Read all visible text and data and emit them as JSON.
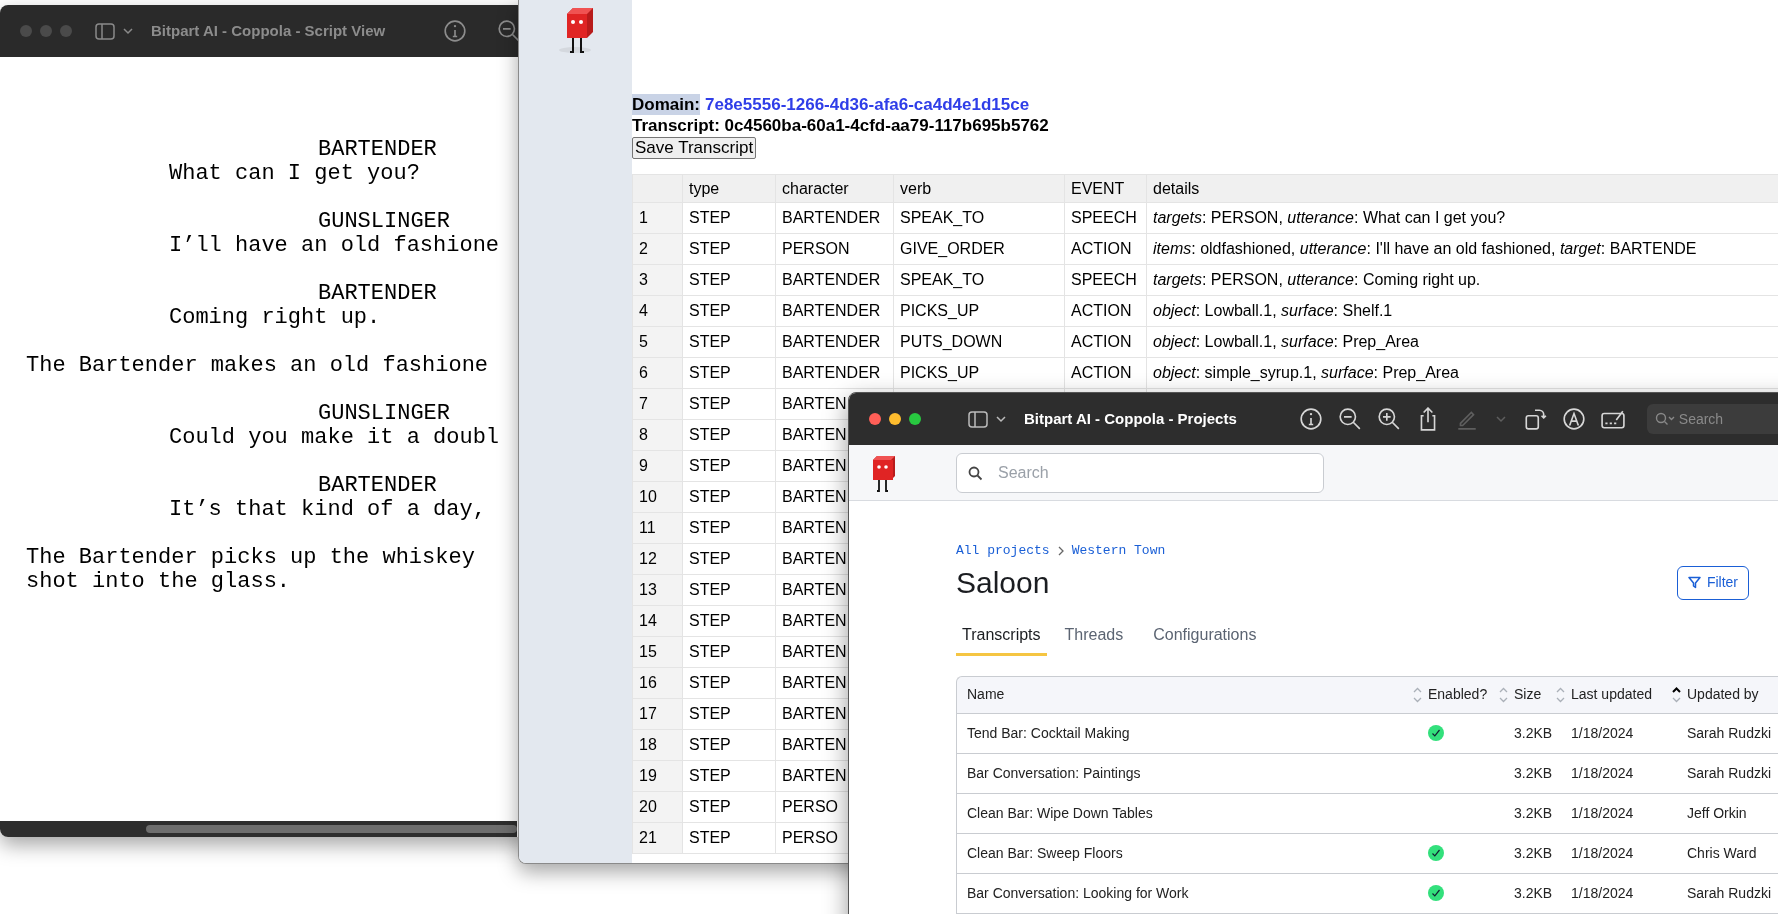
{
  "script_window": {
    "title": "Bitpart AI - Coppola - Script View",
    "active": false,
    "toolbar": [
      {
        "kind": "info",
        "disabled": false
      },
      {
        "kind": "zoom-out",
        "disabled": false
      }
    ],
    "lines": [
      {
        "kind": "character",
        "text": "BARTENDER"
      },
      {
        "kind": "dialogue",
        "text": "What can I get you?"
      },
      {
        "kind": "character",
        "text": "GUNSLINGER"
      },
      {
        "kind": "dialogue",
        "text": "I’ll have an old fashione"
      },
      {
        "kind": "character",
        "text": "BARTENDER"
      },
      {
        "kind": "dialogue",
        "text": "Coming right up."
      },
      {
        "kind": "action",
        "text": "The Bartender makes an old fashione"
      },
      {
        "kind": "character",
        "text": "GUNSLINGER"
      },
      {
        "kind": "dialogue",
        "text": "Could you make it a doubl"
      },
      {
        "kind": "character",
        "text": "BARTENDER"
      },
      {
        "kind": "dialogue",
        "text": "It’s that kind of a day,"
      },
      {
        "kind": "action",
        "text": "The Bartender picks up the whiskey\nshot into the glass."
      }
    ]
  },
  "transcript_window": {
    "domain_label": "Domain:",
    "domain_label_highlighted": true,
    "domain": "7e8e5556-1266-4d36-afa6-ca4d4e1d15ce",
    "transcript": "Transcript: 0c4560ba-60a1-4cfd-aa79-117b695b5762",
    "save_button": "Save Transcript",
    "table": {
      "columns": [
        "type",
        "character",
        "verb",
        "EVENT",
        "details"
      ],
      "rows": [
        {
          "index": "1",
          "type": "STEP",
          "character": "BARTENDER",
          "verb": "SPEAK_TO",
          "event": "SPEECH",
          "details": "*targets*: PERSON, *utterance*: What can I get you?"
        },
        {
          "index": "2",
          "type": "STEP",
          "character": "PERSON",
          "verb": "GIVE_ORDER",
          "event": "ACTION",
          "details": "*items*: oldfashioned, *utterance*: I'll have an old fashioned, *target*: BARTENDE"
        },
        {
          "index": "3",
          "type": "STEP",
          "character": "BARTENDER",
          "verb": "SPEAK_TO",
          "event": "SPEECH",
          "details": "*targets*: PERSON, *utterance*: Coming right up."
        },
        {
          "index": "4",
          "type": "STEP",
          "character": "BARTENDER",
          "verb": "PICKS_UP",
          "event": "ACTION",
          "details": "*object*: Lowball.1, *surface*: Shelf.1"
        },
        {
          "index": "5",
          "type": "STEP",
          "character": "BARTENDER",
          "verb": "PUTS_DOWN",
          "event": "ACTION",
          "details": "*object*: Lowball.1, *surface*: Prep_Area"
        },
        {
          "index": "6",
          "type": "STEP",
          "character": "BARTENDER",
          "verb": "PICKS_UP",
          "event": "ACTION",
          "details": "*object*: simple_syrup.1, *surface*: Prep_Area"
        },
        {
          "index": "7",
          "type": "STEP",
          "character": "BARTEN"
        },
        {
          "index": "8",
          "type": "STEP",
          "character": "BARTEN"
        },
        {
          "index": "9",
          "type": "STEP",
          "character": "BARTEN"
        },
        {
          "index": "10",
          "type": "STEP",
          "character": "BARTEN"
        },
        {
          "index": "11",
          "type": "STEP",
          "character": "BARTEN"
        },
        {
          "index": "12",
          "type": "STEP",
          "character": "BARTEN"
        },
        {
          "index": "13",
          "type": "STEP",
          "character": "BARTEN"
        },
        {
          "index": "14",
          "type": "STEP",
          "character": "BARTEN"
        },
        {
          "index": "15",
          "type": "STEP",
          "character": "BARTEN"
        },
        {
          "index": "16",
          "type": "STEP",
          "character": "BARTEN"
        },
        {
          "index": "17",
          "type": "STEP",
          "character": "BARTEN"
        },
        {
          "index": "18",
          "type": "STEP",
          "character": "BARTEN"
        },
        {
          "index": "19",
          "type": "STEP",
          "character": "BARTEN"
        },
        {
          "index": "20",
          "type": "STEP",
          "character": "PERSO"
        },
        {
          "index": "21",
          "type": "STEP",
          "character": "PERSO"
        }
      ]
    }
  },
  "projects_window": {
    "title": "Bitpart AI - Coppola - Projects",
    "active": true,
    "toolbar": [
      {
        "kind": "info",
        "disabled": false
      },
      {
        "kind": "zoom-out",
        "disabled": false
      },
      {
        "kind": "zoom-in",
        "disabled": false
      },
      {
        "kind": "share",
        "disabled": false
      },
      {
        "kind": "pen",
        "disabled": true
      },
      {
        "kind": "chevron",
        "disabled": true
      },
      {
        "kind": "rotate",
        "disabled": false
      },
      {
        "kind": "markup",
        "disabled": false
      },
      {
        "kind": "signature",
        "disabled": false
      }
    ],
    "toolbar_search": {
      "placeholder": "Search"
    },
    "search": {
      "placeholder": "Search"
    },
    "breadcrumb": [
      "All projects",
      "Western Town"
    ],
    "heading": "Saloon",
    "filter_button": "Filter",
    "tabs": [
      {
        "label": "Transcripts",
        "selected": true
      },
      {
        "label": "Threads",
        "selected": false
      },
      {
        "label": "Configurations",
        "selected": false
      }
    ],
    "table": {
      "columns": [
        {
          "label": "Name",
          "sortable": true,
          "sorted": false
        },
        {
          "label": "Enabled?",
          "sortable": true,
          "sorted": false
        },
        {
          "label": "Size",
          "sortable": true,
          "sorted": false
        },
        {
          "label": "Last updated",
          "sortable": true,
          "sorted": true
        },
        {
          "label": "Updated by",
          "sortable": false
        }
      ],
      "rows": [
        {
          "name": "Tend Bar: Cocktail Making",
          "enabled": true,
          "size": "3.2KB",
          "last_updated": "1/18/2024",
          "updated_by": "Sarah Rudzki"
        },
        {
          "name": "Bar Conversation: Paintings",
          "enabled": false,
          "size": "3.2KB",
          "last_updated": "1/18/2024",
          "updated_by": "Sarah Rudzki"
        },
        {
          "name": "Clean Bar: Wipe Down Tables",
          "enabled": false,
          "size": "3.2KB",
          "last_updated": "1/18/2024",
          "updated_by": "Jeff Orkin"
        },
        {
          "name": "Clean Bar: Sweep Floors",
          "enabled": true,
          "size": "3.2KB",
          "last_updated": "1/18/2024",
          "updated_by": "Chris Ward"
        },
        {
          "name": "Bar Conversation: Looking for Work",
          "enabled": true,
          "size": "3.2KB",
          "last_updated": "1/18/2024",
          "updated_by": "Sarah Rudzki"
        }
      ]
    }
  }
}
